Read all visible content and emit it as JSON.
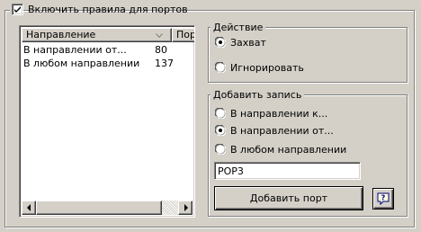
{
  "enable_rules": {
    "label": "Включить правила для портов",
    "checked": true
  },
  "port_list": {
    "columns": [
      "Направление",
      "Порт"
    ],
    "sort_indicator": "chevron-down-icon",
    "rows": [
      {
        "direction": "В направлении от...",
        "port": "80"
      },
      {
        "direction": "В любом направлении",
        "port": "137"
      }
    ]
  },
  "action": {
    "title": "Действие",
    "options": [
      "Захват",
      "Игнорировать"
    ],
    "selected": "Захват"
  },
  "add_entry": {
    "title": "Добавить запись",
    "options": [
      "В направлении к...",
      "В направлении от...",
      "В любом направлении"
    ],
    "selected": "В направлении от...",
    "port_value": "POP3",
    "add_button_label": "Добавить порт",
    "help_icon": "help-icon"
  }
}
